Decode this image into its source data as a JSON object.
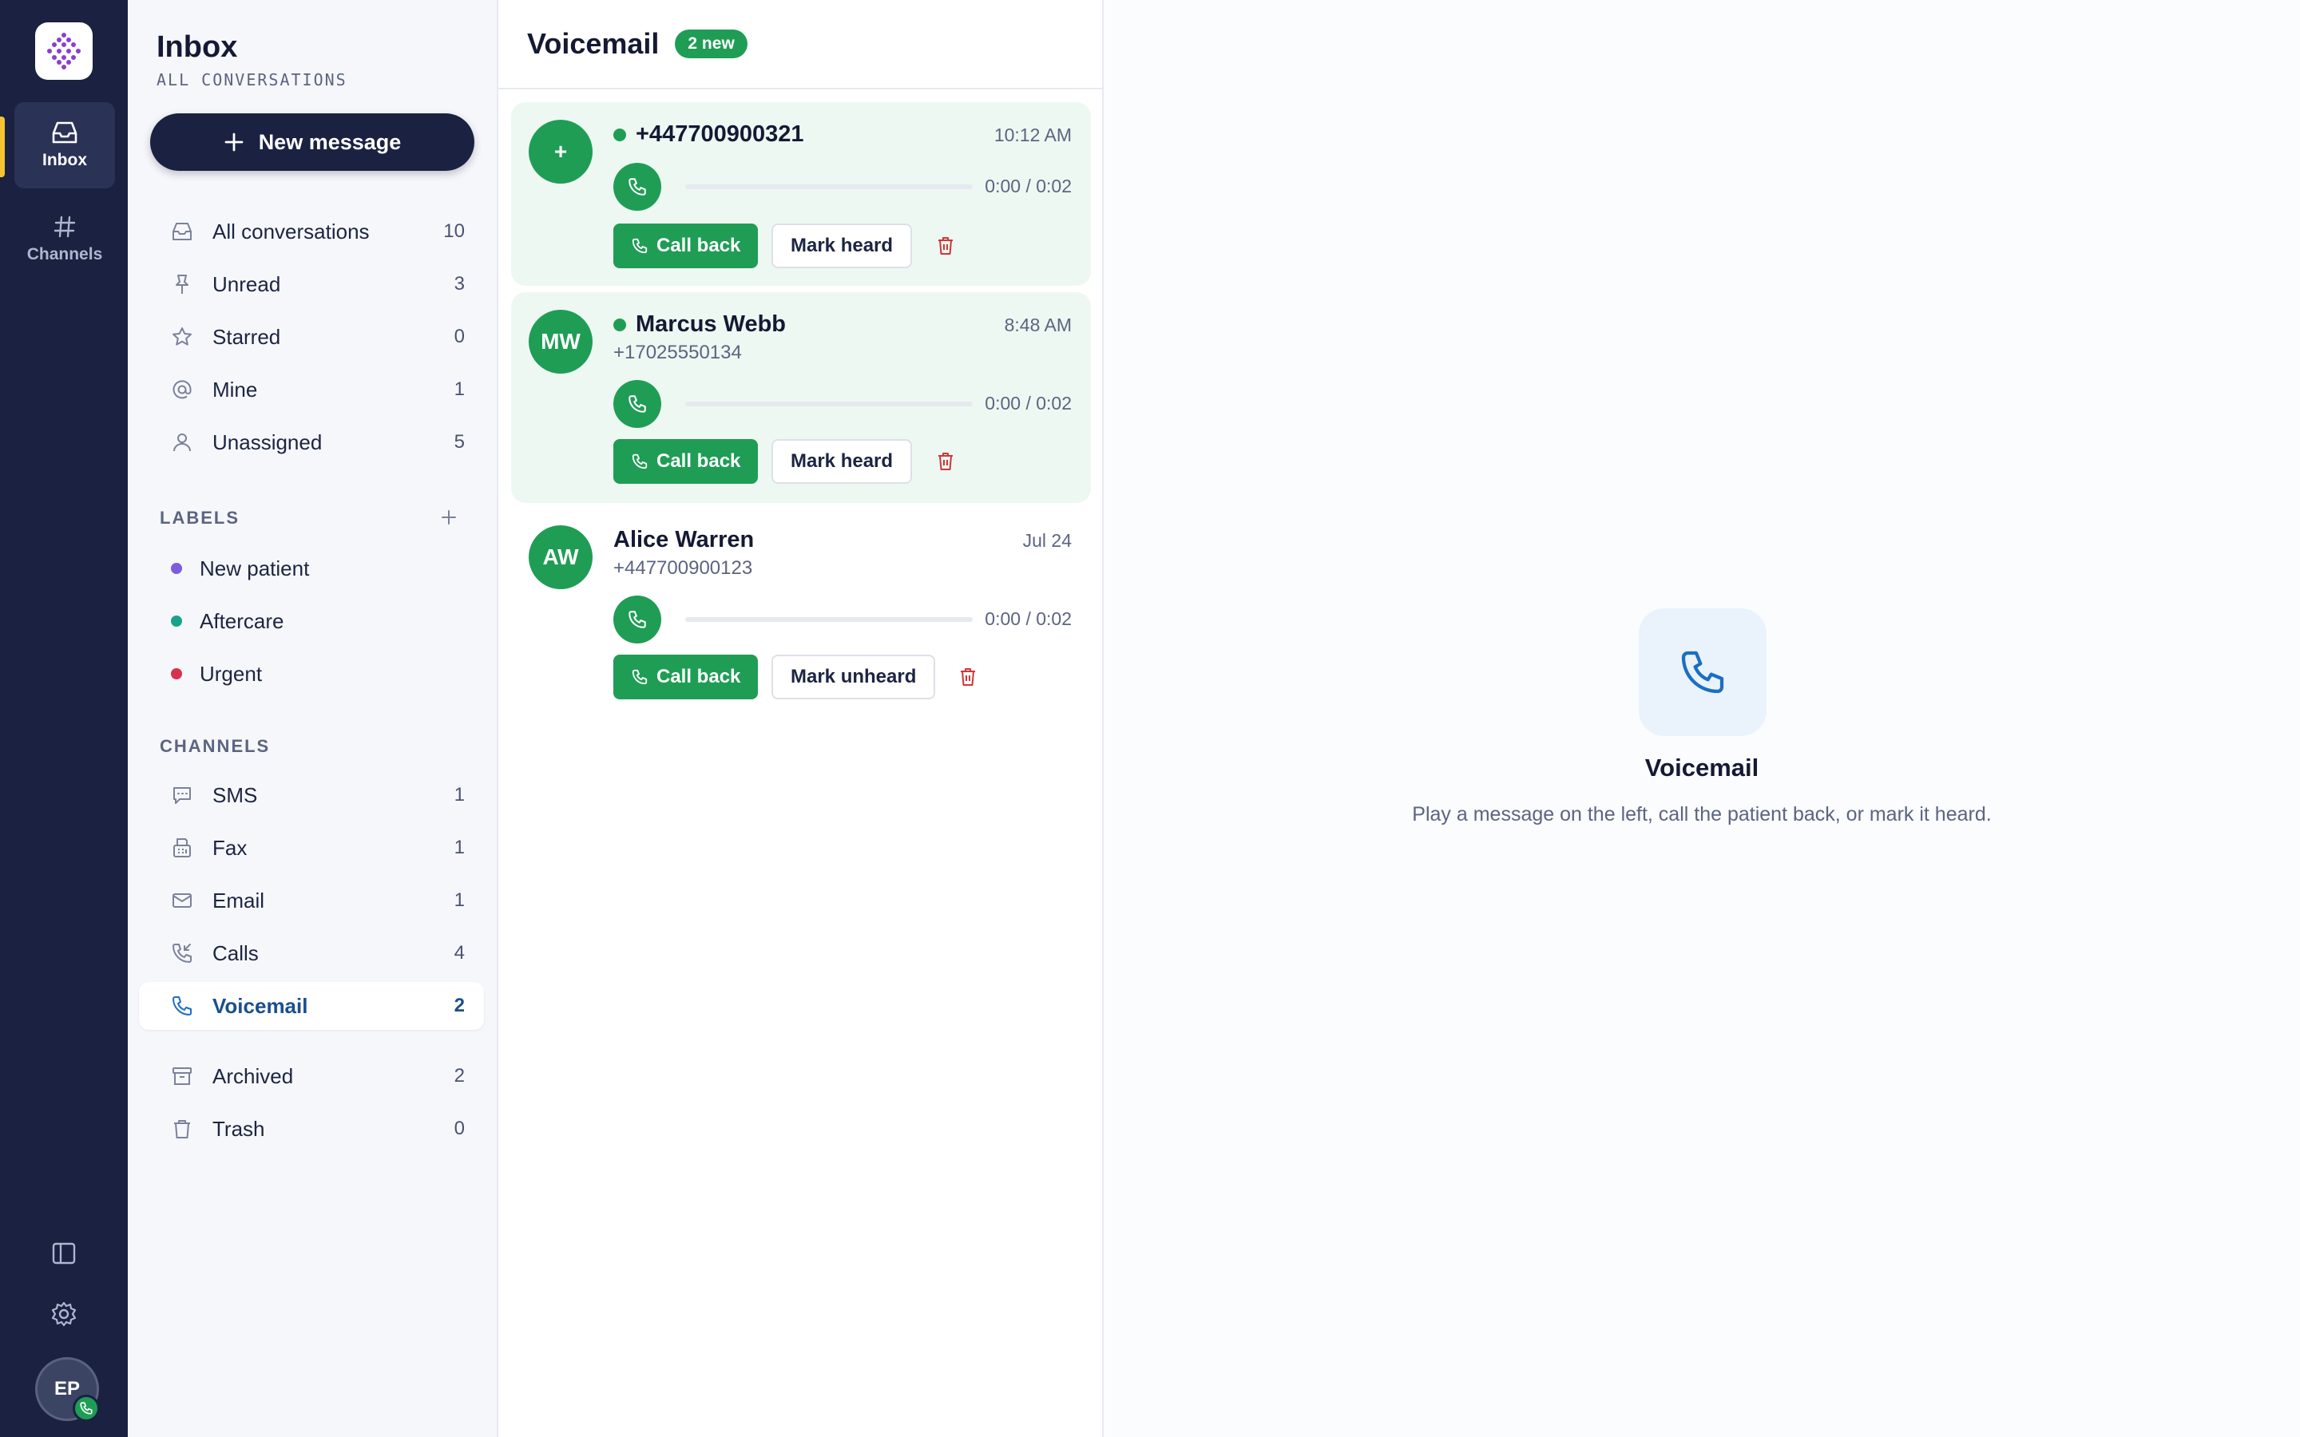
{
  "colors": {
    "rail_bg": "#1a2141",
    "accent_green": "#1f9d55",
    "active_blue": "#1b4f8c",
    "delete_red": "#d0353a",
    "label_new_patient": "#7c5ce0",
    "label_aftercare": "#16a38a",
    "label_urgent": "#d9304f"
  },
  "rail": {
    "logo": "app-logo",
    "items": [
      {
        "label": "Inbox",
        "icon": "inbox-icon",
        "active": true
      },
      {
        "label": "Channels",
        "icon": "hash-icon",
        "active": false
      }
    ],
    "bottom": {
      "panel_toggle_icon": "sidebar-toggle-icon",
      "settings_icon": "gear-icon"
    },
    "user": {
      "initials": "EP",
      "presence_icon": "phone-icon"
    }
  },
  "sidebar": {
    "title": "Inbox",
    "subtitle": "ALL CONVERSATIONS",
    "new_message_label": "New message",
    "nav": [
      {
        "label": "All conversations",
        "count": "10",
        "icon": "inbox-icon"
      },
      {
        "label": "Unread",
        "count": "3",
        "icon": "pin-icon"
      },
      {
        "label": "Starred",
        "count": "0",
        "icon": "star-icon"
      },
      {
        "label": "Mine",
        "count": "1",
        "icon": "at-icon"
      },
      {
        "label": "Unassigned",
        "count": "5",
        "icon": "user-icon"
      }
    ],
    "labels_heading": "LABELS",
    "labels": [
      {
        "label": "New patient",
        "color": "#7c5ce0"
      },
      {
        "label": "Aftercare",
        "color": "#16a38a"
      },
      {
        "label": "Urgent",
        "color": "#d9304f"
      }
    ],
    "channels_heading": "CHANNELS",
    "channels": [
      {
        "label": "SMS",
        "count": "1",
        "icon": "chat-icon"
      },
      {
        "label": "Fax",
        "count": "1",
        "icon": "fax-icon"
      },
      {
        "label": "Email",
        "count": "1",
        "icon": "mail-icon"
      },
      {
        "label": "Calls",
        "count": "4",
        "icon": "phone-incoming-icon"
      },
      {
        "label": "Voicemail",
        "count": "2",
        "icon": "phone-icon",
        "active": true
      }
    ],
    "other": [
      {
        "label": "Archived",
        "count": "2",
        "icon": "archive-icon"
      },
      {
        "label": "Trash",
        "count": "0",
        "icon": "trash-icon"
      }
    ]
  },
  "list": {
    "title": "Voicemail",
    "badge": "2 new",
    "items": [
      {
        "avatar": "+",
        "name": "+447700900321",
        "subtitle": "",
        "time": "10:12 AM",
        "duration": "0:00 / 0:02",
        "progress": 0,
        "unheard": true,
        "callback_label": "Call back",
        "mark_label": "Mark heard"
      },
      {
        "avatar": "MW",
        "name": "Marcus Webb",
        "subtitle": "+17025550134",
        "time": "8:48 AM",
        "duration": "0:00 / 0:02",
        "progress": 0,
        "unheard": true,
        "callback_label": "Call back",
        "mark_label": "Mark heard"
      },
      {
        "avatar": "AW",
        "name": "Alice Warren",
        "subtitle": "+447700900123",
        "time": "Jul 24",
        "duration": "0:00 / 0:02",
        "progress": 0,
        "unheard": false,
        "callback_label": "Call back",
        "mark_label": "Mark unheard"
      }
    ]
  },
  "detail": {
    "icon": "phone-icon",
    "title": "Voicemail",
    "description": "Play a message on the left, call the patient back, or mark it heard."
  }
}
